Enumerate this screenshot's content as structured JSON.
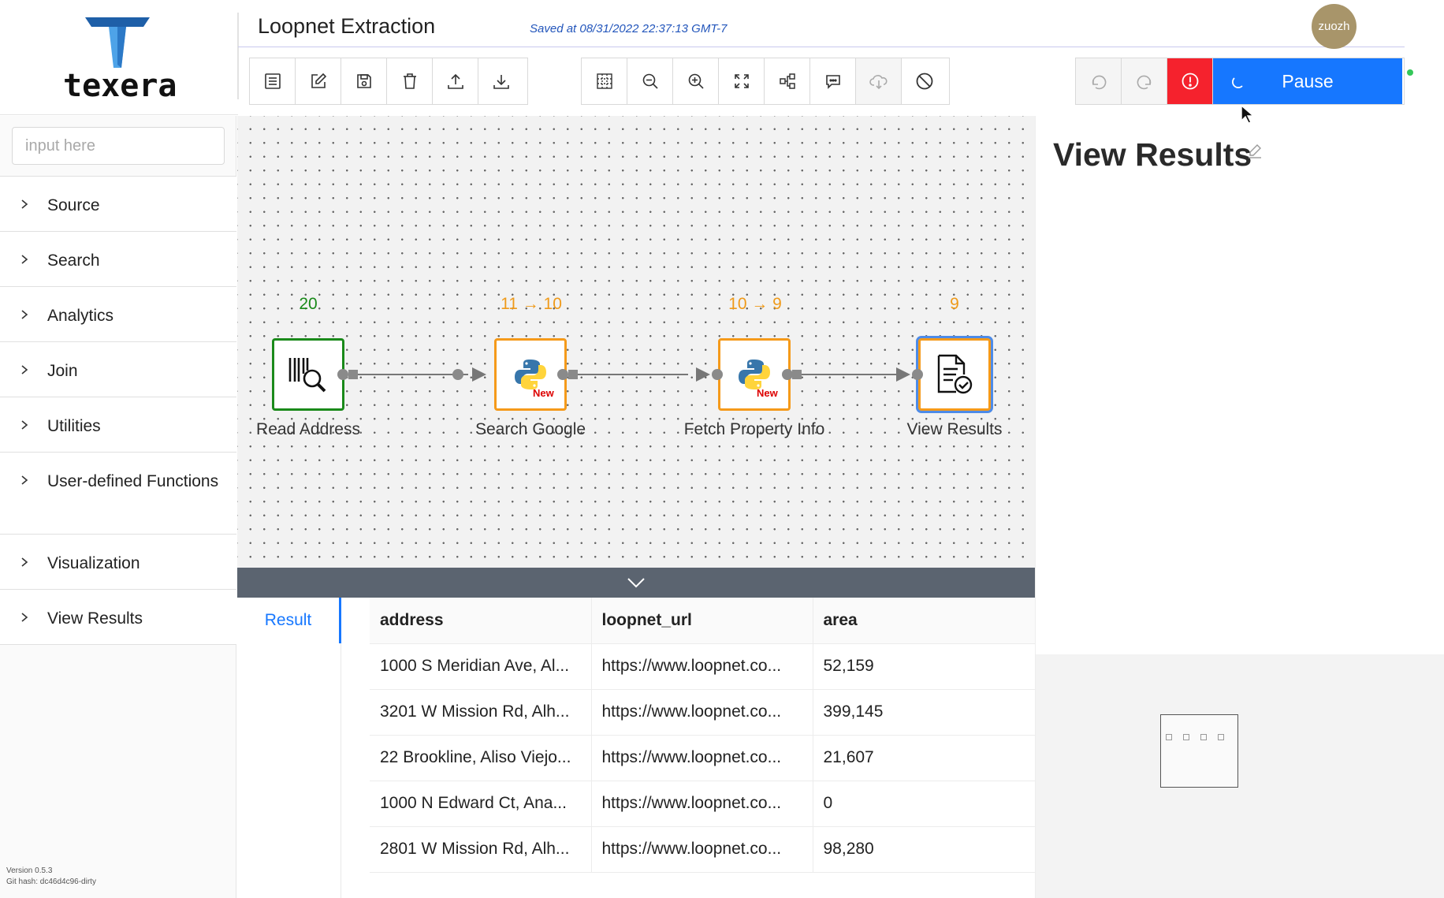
{
  "brand": {
    "wordmark": "texera",
    "accent": "#1677ff"
  },
  "header": {
    "workflow_name": "Loopnet Extraction",
    "saved_status": "Saved at 08/31/2022 22:37:13 GMT-7",
    "user_initials": "zuozh"
  },
  "toolbar": {
    "file_actions": [
      "list-icon",
      "edit-icon",
      "save-icon",
      "delete-icon",
      "upload-icon",
      "download-icon"
    ],
    "view_actions": [
      "grid-icon",
      "zoom-out-icon",
      "zoom-in-icon",
      "fullscreen-icon",
      "layout-icon",
      "comment-icon",
      "cloud-icon",
      "disable-icon"
    ],
    "undo_icon": "undo-icon",
    "redo_icon": "redo-icon",
    "error_icon": "error-icon",
    "run_label": "Pause",
    "run_color": "#1677ff",
    "error_color": "#f5222d"
  },
  "sidebar": {
    "search_placeholder": "input here",
    "categories": [
      {
        "label": "Source"
      },
      {
        "label": "Search"
      },
      {
        "label": "Analytics"
      },
      {
        "label": "Join"
      },
      {
        "label": "Utilities"
      },
      {
        "label": "User-defined Functions"
      },
      {
        "label": "Visualization"
      },
      {
        "label": "View Results"
      }
    ],
    "version": "Version 0.5.3",
    "git_hash": "Git hash: dc46d4c96-dirty"
  },
  "workflow": {
    "operators": [
      {
        "label": "Read Address",
        "count": "20",
        "count_color": "#1a8a1a",
        "border_color": "#1a8a1a",
        "icon": "barcode-search-icon"
      },
      {
        "label": "Search Google",
        "count": "11 → 10",
        "count_color": "#ef9a1a",
        "border_color": "#f59a1a",
        "icon": "python-icon",
        "badge": "New"
      },
      {
        "label": "Fetch Property Info",
        "count": "10 → 9",
        "count_color": "#ef9a1a",
        "border_color": "#f59a1a",
        "icon": "python-icon",
        "badge": "New"
      },
      {
        "label": "View Results",
        "count": "9",
        "count_color": "#ef9a1a",
        "border_color": "#f59a1a",
        "icon": "document-check-icon"
      }
    ]
  },
  "results": {
    "tab_label": "Result",
    "columns": [
      "address",
      "loopnet_url",
      "area"
    ],
    "rows": [
      [
        "1000 S Meridian Ave, Al...",
        "https://www.loopnet.co...",
        "52,159"
      ],
      [
        "3201 W Mission Rd, Alh...",
        "https://www.loopnet.co...",
        "399,145"
      ],
      [
        "22 Brookline, Aliso Viejo...",
        "https://www.loopnet.co...",
        "21,607"
      ],
      [
        "1000 N Edward Ct, Ana...",
        "https://www.loopnet.co...",
        "0"
      ],
      [
        "2801 W Mission Rd, Alh...",
        "https://www.loopnet.co...",
        "98,280"
      ]
    ]
  },
  "properties": {
    "title": "View Results"
  }
}
